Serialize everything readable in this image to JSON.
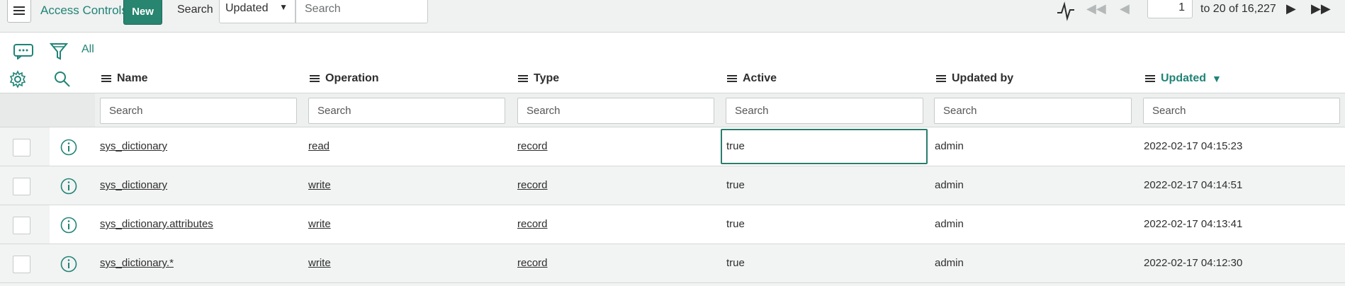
{
  "header": {
    "title": "Access Controls",
    "new_label": "New",
    "search_label": "Search",
    "search_field": "Updated",
    "search_placeholder": "Search"
  },
  "pagination": {
    "current": "1",
    "range_text": "to 20 of 16,227"
  },
  "filter": {
    "all_label": "All"
  },
  "columns": [
    {
      "label": "Name"
    },
    {
      "label": "Operation"
    },
    {
      "label": "Type"
    },
    {
      "label": "Active"
    },
    {
      "label": "Updated by"
    },
    {
      "label": "Updated",
      "sorted": "desc"
    }
  ],
  "column_search_placeholder": "Search",
  "rows": [
    {
      "name": "sys_dictionary",
      "operation": "read",
      "type": "record",
      "active": "true",
      "updated_by": "admin",
      "updated": "2022-02-17 04:15:23"
    },
    {
      "name": "sys_dictionary",
      "operation": "write",
      "type": "record",
      "active": "true",
      "updated_by": "admin",
      "updated": "2022-02-17 04:14:51"
    },
    {
      "name": "sys_dictionary.attributes",
      "operation": "write",
      "type": "record",
      "active": "true",
      "updated_by": "admin",
      "updated": "2022-02-17 04:13:41"
    },
    {
      "name": "sys_dictionary.*",
      "operation": "write",
      "type": "record",
      "active": "true",
      "updated_by": "admin",
      "updated": "2022-02-17 04:12:30"
    }
  ],
  "colors": {
    "accent": "#1f8476",
    "new_button": "#278570",
    "row_alt": "#f2f3f3"
  },
  "icons": [
    "menu-icon",
    "activity-icon",
    "first-page-icon",
    "prev-page-icon",
    "next-page-icon",
    "last-page-icon",
    "comments-icon",
    "filter-icon",
    "gear-icon",
    "search-icon",
    "info-icon",
    "sort-desc-icon"
  ]
}
